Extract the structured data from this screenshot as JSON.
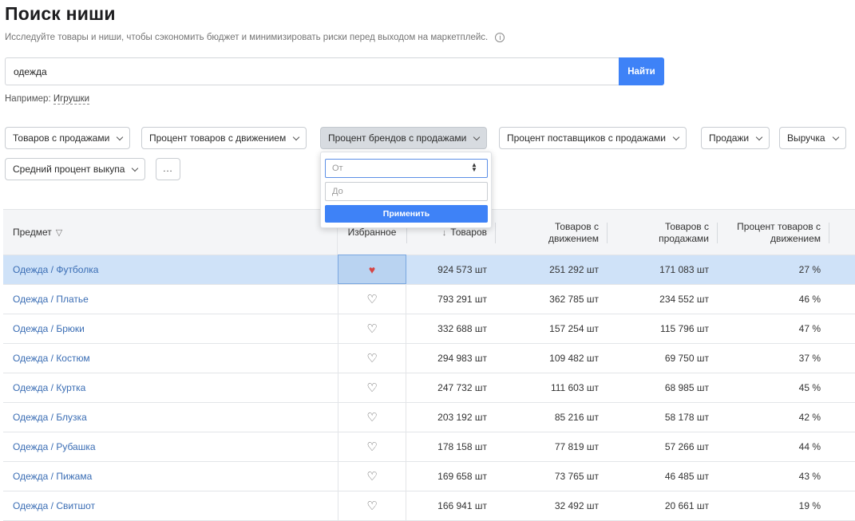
{
  "header": {
    "title": "Поиск ниши",
    "subtitle": "Исследуйте товары и ниши, чтобы сэкономить бюджет и минимизировать риски перед выходом на маркетплейс.",
    "info_icon": "info-icon"
  },
  "search": {
    "value": "одежда",
    "button": "Найти",
    "example_prefix": "Например:",
    "example_link": "Игрушки"
  },
  "filters": [
    {
      "label": "Товаров с продажами",
      "active": false
    },
    {
      "label": "Процент товаров с движением",
      "active": false
    },
    {
      "label": "Процент брендов с продажами",
      "active": true
    },
    {
      "label": "Процент поставщиков с продажами",
      "active": false
    },
    {
      "label": "Продажи",
      "active": false
    },
    {
      "label": "Выручка",
      "active": false
    },
    {
      "label": "Средний процент выкупа",
      "active": false
    },
    {
      "label": "...",
      "active": false
    }
  ],
  "dropdown": {
    "from_placeholder": "От",
    "to_placeholder": "До",
    "apply": "Применить"
  },
  "table": {
    "columns": {
      "subject": "Предмет",
      "favorite": "Избранное",
      "products": "Товаров",
      "with_movement": "Товаров с движением",
      "with_sales": "Товаров с продажами",
      "percent_movement": "Процент товаров с движением"
    },
    "rows": [
      {
        "name": "Одежда / Футболка",
        "favorite": true,
        "products": "924 573 шт",
        "movement": "251 292 шт",
        "sales": "171 083 шт",
        "percent": "27 %"
      },
      {
        "name": "Одежда / Платье",
        "favorite": false,
        "products": "793 291 шт",
        "movement": "362 785 шт",
        "sales": "234 552 шт",
        "percent": "46 %"
      },
      {
        "name": "Одежда / Брюки",
        "favorite": false,
        "products": "332 688 шт",
        "movement": "157 254 шт",
        "sales": "115 796 шт",
        "percent": "47 %"
      },
      {
        "name": "Одежда / Костюм",
        "favorite": false,
        "products": "294 983 шт",
        "movement": "109 482 шт",
        "sales": "69 750 шт",
        "percent": "37 %"
      },
      {
        "name": "Одежда / Куртка",
        "favorite": false,
        "products": "247 732 шт",
        "movement": "111 603 шт",
        "sales": "68 985 шт",
        "percent": "45 %"
      },
      {
        "name": "Одежда / Блузка",
        "favorite": false,
        "products": "203 192 шт",
        "movement": "85 216 шт",
        "sales": "58 178 шт",
        "percent": "42 %"
      },
      {
        "name": "Одежда / Рубашка",
        "favorite": false,
        "products": "178 158 шт",
        "movement": "77 819 шт",
        "sales": "57 266 шт",
        "percent": "44 %"
      },
      {
        "name": "Одежда / Пижама",
        "favorite": false,
        "products": "169 658 шт",
        "movement": "73 765 шт",
        "sales": "46 485 шт",
        "percent": "43 %"
      },
      {
        "name": "Одежда / Свитшот",
        "favorite": false,
        "products": "166 941 шт",
        "movement": "32 492 шт",
        "sales": "20 661 шт",
        "percent": "19 %"
      }
    ]
  }
}
